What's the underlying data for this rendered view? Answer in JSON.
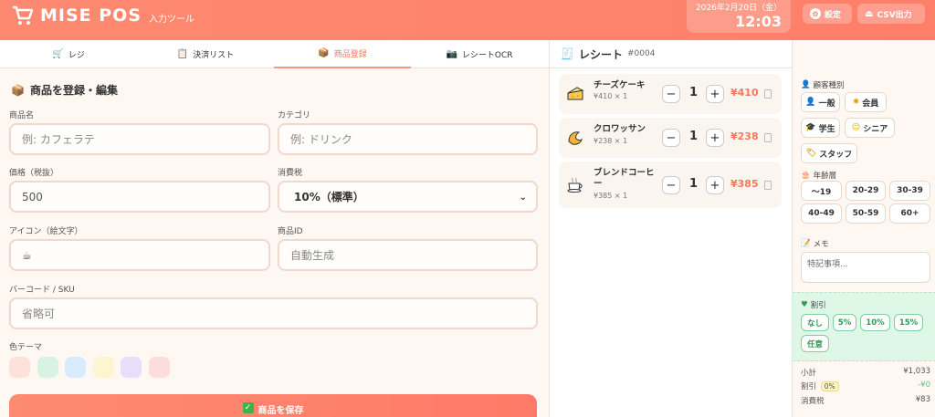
{
  "header": {
    "brand": "MISE POS",
    "subtitle": "入力ツール",
    "date": "2026年2月20日（金）",
    "time": "12:03",
    "settings_label": "設定",
    "csv_label": "CSV出力"
  },
  "tabs": [
    {
      "label": "レジ",
      "icon": "cart-icon"
    },
    {
      "label": "決済リスト",
      "icon": "clipboard-icon"
    },
    {
      "label": "商品登録",
      "icon": "package-icon"
    },
    {
      "label": "レシートOCR",
      "icon": "camera-icon"
    }
  ],
  "active_tab": "商品登録",
  "form": {
    "title": "商品を登録・編集",
    "name_label": "商品名",
    "name_placeholder": "例: カフェラテ",
    "category_label": "カテゴリ",
    "category_placeholder": "例: ドリンク",
    "price_label": "価格（税抜）",
    "price_value": "500",
    "tax_label": "消費税",
    "tax_value": "10%（標準）",
    "icon_label": "アイコン（絵文字）",
    "icon_value": "☕",
    "id_label": "商品ID",
    "id_placeholder": "自動生成",
    "sku_label": "バーコード / SKU",
    "sku_placeholder": "省略可",
    "color_label": "色テーマ",
    "colors": [
      "#fde2dc",
      "#d9f3e3",
      "#d8ebfd",
      "#fdf5cf",
      "#e8defc",
      "#fddcdc"
    ],
    "save_label": "商品を保存"
  },
  "receipt": {
    "title": "レシート",
    "number": "#0004",
    "items": [
      {
        "name": "チーズケーキ",
        "sub": "¥410 × 1",
        "qty": "1",
        "price": "¥410",
        "icon": "cheesecake-icon"
      },
      {
        "name": "クロワッサン",
        "sub": "¥238 × 1",
        "qty": "1",
        "price": "¥238",
        "icon": "croissant-icon"
      },
      {
        "name": "ブレンドコーヒー",
        "sub": "¥385 × 1",
        "qty": "1",
        "price": "¥385",
        "icon": "coffee-icon"
      }
    ],
    "minus": "−",
    "plus": "+"
  },
  "sidebar": {
    "customer_label": "顧客種別",
    "customer_types": [
      "一般",
      "会員",
      "学生",
      "シニア",
      "スタッフ"
    ],
    "age_label": "年齢層",
    "ages": [
      "〜19",
      "20-29",
      "30-39",
      "40-49",
      "50-59",
      "60+"
    ],
    "memo_label": "メモ",
    "memo_placeholder": "特記事項...",
    "discount_label": "割引",
    "discounts": [
      "なし",
      "5%",
      "10%",
      "15%",
      "任意"
    ],
    "subtotal_label": "小計",
    "subtotal_value": "¥1,033",
    "discount_row_label": "割引",
    "discount_badge": "0%",
    "discount_value": "-¥0",
    "tax_label": "消費税",
    "tax_value": "¥83"
  }
}
